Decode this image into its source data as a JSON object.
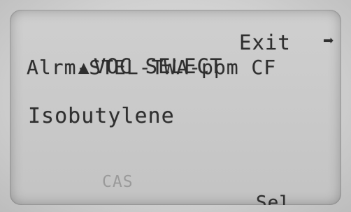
{
  "header": {
    "left_arrow_icon": "up-arrow-icon",
    "title": "VOC SELECT",
    "exit_label": "Exit",
    "right_arrow_icon": "right-arrow-icon"
  },
  "subheader": {
    "label": "Alrm-STEL-TWA-ppm CF"
  },
  "selection": {
    "compound": "Isobutylene"
  },
  "footer": {
    "cas_label": "CAS",
    "softkey_label": "Sel"
  }
}
